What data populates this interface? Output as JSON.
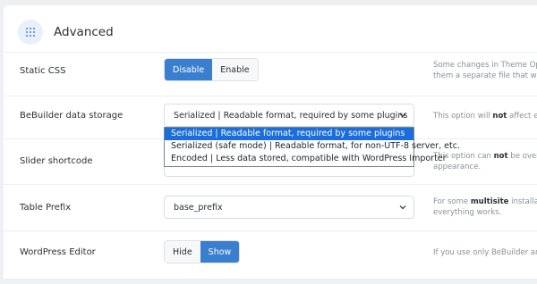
{
  "header": {
    "title": "Advanced",
    "icon": "grid-dots-icon"
  },
  "rows": {
    "static_css": {
      "label": "Static CSS",
      "buttons": [
        "Disable",
        "Enable"
      ],
      "active": "Disable",
      "desc_line1": "Some changes in Theme Option",
      "desc_line2": "them a separate file that will cr"
    },
    "bebuilder_storage": {
      "label": "BeBuilder data storage",
      "selected": "Serialized | Readable format, required by some plugins",
      "desc_pre": "This option will ",
      "desc_bold": "not",
      "desc_post": " affect existin"
    },
    "slider_shortcode": {
      "label": "Slider shortcode",
      "desc_pre": "This option can ",
      "desc_bold": "not",
      "desc_post": " be overwrit",
      "desc_line2": "appearance."
    },
    "table_prefix": {
      "label": "Table Prefix",
      "selected": "base_prefix",
      "desc_pre": "For some ",
      "desc_bold": "multisite",
      "desc_post": " installations",
      "desc_line2": "everything works."
    },
    "wp_editor": {
      "label": "WordPress Editor",
      "buttons": [
        "Hide",
        "Show"
      ],
      "active": "Show",
      "desc": "If you use only BeBuilder and do"
    }
  },
  "dropdown_options": [
    "Serialized | Readable format, required by some plugins",
    "Serialized (safe mode) | Readable format, for non-UTF-8 server, etc.",
    "Encoded | Less data stored, compatible with WordPress Importer"
  ],
  "colors": {
    "accent": "#3a7fcf",
    "dropdown_highlight": "#1a6ddc"
  }
}
